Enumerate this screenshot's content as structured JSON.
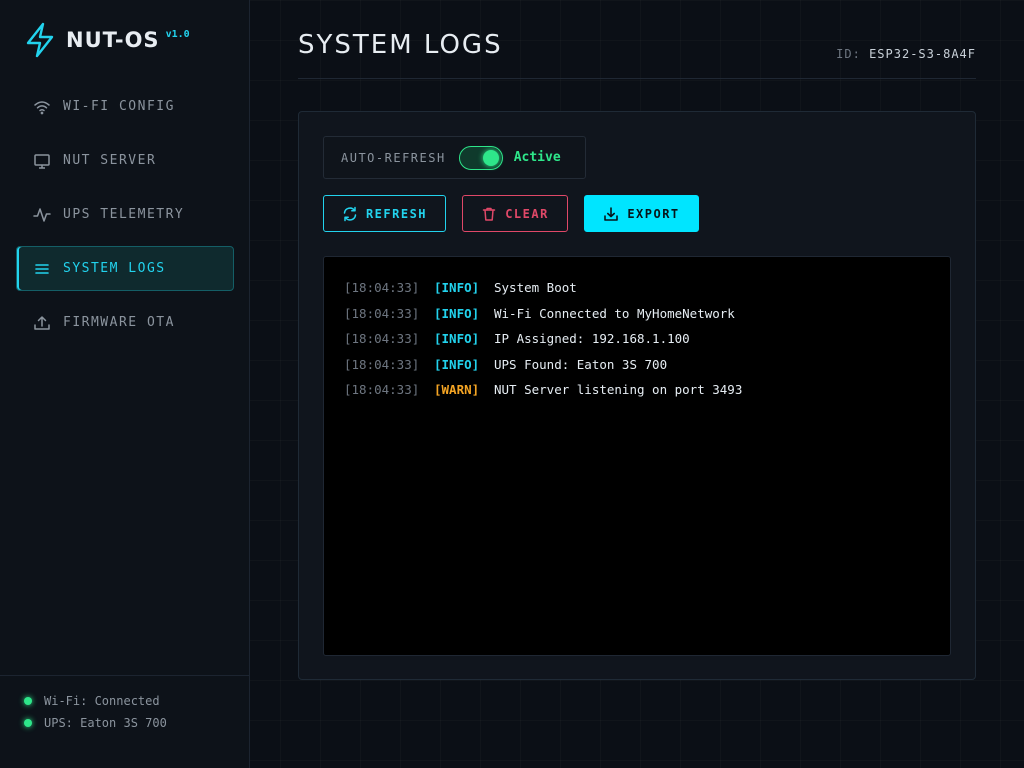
{
  "brand": {
    "name": "NUT-OS",
    "version": "v1.0",
    "icon": "lightning-bolt-icon",
    "accent": "#22d3ee"
  },
  "sidebar": {
    "items": [
      {
        "label": "WI-FI CONFIG",
        "icon": "wifi-icon",
        "active": false
      },
      {
        "label": "NUT SERVER",
        "icon": "monitor-icon",
        "active": false
      },
      {
        "label": "UPS TELEMETRY",
        "icon": "activity-icon",
        "active": false
      },
      {
        "label": "SYSTEM LOGS",
        "icon": "list-icon",
        "active": true
      },
      {
        "label": "FIRMWARE OTA",
        "icon": "upload-icon",
        "active": false
      }
    ],
    "status": [
      {
        "text": "Wi-Fi: Connected",
        "color": "#2ee68a"
      },
      {
        "text": "UPS: Eaton 3S 700",
        "color": "#2ee68a"
      }
    ]
  },
  "header": {
    "title": "SYSTEM LOGS",
    "device_id_label": "ID:",
    "device_id_value": "ESP32-S3-8A4F"
  },
  "controls": {
    "auto_refresh_label": "AUTO-REFRESH",
    "auto_refresh_on": true,
    "auto_refresh_state": "Active",
    "refresh_label": "REFRESH",
    "clear_label": "CLEAR",
    "export_label": "EXPORT"
  },
  "logs": [
    {
      "time": "[18:04:33]",
      "level": "[INFO]",
      "type": "info",
      "message": "System Boot"
    },
    {
      "time": "[18:04:33]",
      "level": "[INFO]",
      "type": "info",
      "message": "Wi-Fi Connected to MyHomeNetwork"
    },
    {
      "time": "[18:04:33]",
      "level": "[INFO]",
      "type": "info",
      "message": "IP Assigned: 192.168.1.100"
    },
    {
      "time": "[18:04:33]",
      "level": "[INFO]",
      "type": "info",
      "message": "UPS Found: Eaton 3S 700"
    },
    {
      "time": "[18:04:33]",
      "level": "[WARN]",
      "type": "warn",
      "message": "NUT Server listening on port 3493"
    }
  ],
  "colors": {
    "info": "#22d3ee",
    "warn": "#f5a524",
    "ok": "#2ee68a",
    "danger": "#e04868"
  }
}
